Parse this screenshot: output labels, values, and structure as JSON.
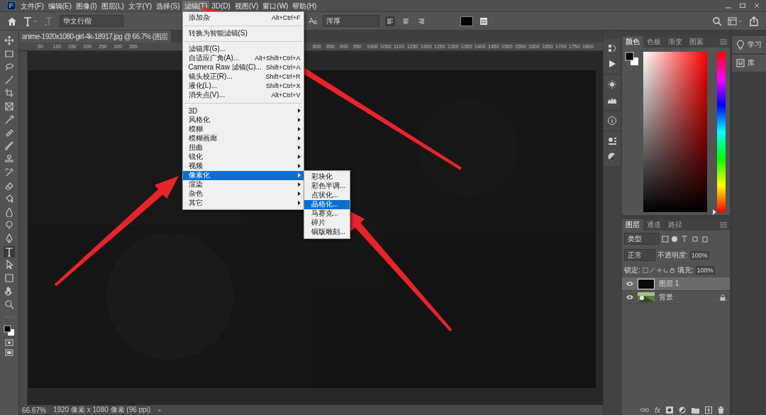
{
  "menu_bar": {
    "items": [
      {
        "label": "文件(F)",
        "selected": false
      },
      {
        "label": "编辑(E)",
        "selected": false
      },
      {
        "label": "图像(I)",
        "selected": false
      },
      {
        "label": "图层(L)",
        "selected": false
      },
      {
        "label": "文字(Y)",
        "selected": false
      },
      {
        "label": "选择(S)",
        "selected": false
      },
      {
        "label": "滤镜(T)",
        "selected": true
      },
      {
        "label": "3D(D)",
        "selected": false
      },
      {
        "label": "视图(V)",
        "selected": false
      },
      {
        "label": "窗口(W)",
        "selected": false
      },
      {
        "label": "帮助(H)",
        "selected": false
      }
    ]
  },
  "options_bar": {
    "font_family": "华文行楷",
    "anti_alias": "浑厚"
  },
  "document_tab": {
    "title": "anime-1920x1080-girl-4k-18917.jpg @ 66.7% (图层"
  },
  "ruler": {
    "labels_before_menu": [
      "50",
      "100",
      "150",
      "200",
      "250",
      "300",
      "350"
    ],
    "labels_after_menu": [
      "800",
      "850",
      "900",
      "950",
      "1000",
      "1050",
      "1100",
      "1150",
      "1200",
      "1250",
      "1300",
      "1350",
      "1400",
      "1450",
      "1500",
      "1550",
      "1600",
      "1650",
      "1700",
      "1750",
      "1800"
    ]
  },
  "toolbar": {
    "tools": [
      {
        "kind": "move",
        "selected": false
      },
      {
        "kind": "marquee",
        "selected": false
      },
      {
        "kind": "lasso",
        "selected": false
      },
      {
        "kind": "wand",
        "selected": false
      },
      {
        "kind": "crop",
        "selected": false
      },
      {
        "kind": "frame",
        "selected": false
      },
      {
        "kind": "eyedropper",
        "selected": false
      },
      {
        "kind": "healing",
        "selected": false
      },
      {
        "kind": "brush",
        "selected": false
      },
      {
        "kind": "stamp",
        "selected": false
      },
      {
        "kind": "history",
        "selected": false
      },
      {
        "kind": "eraser",
        "selected": false
      },
      {
        "kind": "bucket",
        "selected": false
      },
      {
        "kind": "drop",
        "selected": false
      },
      {
        "kind": "dodge",
        "selected": false
      },
      {
        "kind": "pen",
        "selected": false
      },
      {
        "kind": "type",
        "selected": true
      },
      {
        "kind": "select",
        "selected": false
      },
      {
        "kind": "shape",
        "selected": false
      },
      {
        "kind": "hand",
        "selected": false
      },
      {
        "kind": "zoom",
        "selected": false
      },
      {
        "kind": "more",
        "selected": false
      }
    ]
  },
  "filter_menu": {
    "items": [
      {
        "kind": "command",
        "label": "添加杂",
        "shortcut": "Alt+Ctrl+F",
        "selected": false
      },
      {
        "kind": "separator"
      },
      {
        "kind": "command",
        "label": "转换为智能滤镜(S)",
        "selected": false
      },
      {
        "kind": "separator"
      },
      {
        "kind": "command",
        "label": "滤镜库(G)...",
        "selected": false
      },
      {
        "kind": "command",
        "label": "自适应广角(A)...",
        "shortcut": "Alt+Shift+Ctrl+A",
        "selected": false
      },
      {
        "kind": "command",
        "label": "Camera Raw 滤镜(C)...",
        "shortcut": "Shift+Ctrl+A",
        "selected": false
      },
      {
        "kind": "command",
        "label": "镜头校正(R)...",
        "shortcut": "Shift+Ctrl+R",
        "selected": false
      },
      {
        "kind": "command",
        "label": "液化(L)...",
        "shortcut": "Shift+Ctrl+X",
        "selected": false
      },
      {
        "kind": "command",
        "label": "消失点(V)...",
        "shortcut": "Alt+Ctrl+V",
        "selected": false
      },
      {
        "kind": "separator"
      },
      {
        "kind": "submenu",
        "label": "3D",
        "selected": false
      },
      {
        "kind": "submenu",
        "label": "风格化",
        "selected": false
      },
      {
        "kind": "submenu",
        "label": "模糊",
        "selected": false
      },
      {
        "kind": "submenu",
        "label": "模糊画廊",
        "selected": false
      },
      {
        "kind": "submenu",
        "label": "扭曲",
        "selected": false
      },
      {
        "kind": "submenu",
        "label": "锐化",
        "selected": false
      },
      {
        "kind": "submenu",
        "label": "视频",
        "selected": false
      },
      {
        "kind": "submenu",
        "label": "像素化",
        "selected": true
      },
      {
        "kind": "submenu",
        "label": "渲染",
        "selected": false
      },
      {
        "kind": "submenu",
        "label": "杂色",
        "selected": false
      },
      {
        "kind": "submenu",
        "label": "其它",
        "selected": false
      }
    ]
  },
  "pixelate_submenu": {
    "items": [
      {
        "label": "彩块化",
        "selected": false
      },
      {
        "label": "彩色半调...",
        "selected": false
      },
      {
        "label": "点状化...",
        "selected": false
      },
      {
        "label": "晶格化...",
        "selected": true
      },
      {
        "label": "马赛克...",
        "selected": false
      },
      {
        "label": "碎片",
        "selected": false
      },
      {
        "label": "铜版雕刻...",
        "selected": false
      }
    ]
  },
  "color_panel": {
    "hue_slider": {
      "level": 0
    },
    "tabs": [
      {
        "label": "颜色",
        "selected": true
      },
      {
        "label": "色板",
        "selected": false
      },
      {
        "label": "渐变",
        "selected": false
      },
      {
        "label": "图案",
        "selected": false
      }
    ]
  },
  "learn_panel": {
    "items": [
      {
        "kind": "learn",
        "label": "学习"
      },
      {
        "kind": "library",
        "label": "库"
      }
    ]
  },
  "layers_panel": {
    "tabs": [
      {
        "label": "图层",
        "selected": true
      },
      {
        "label": "通道",
        "selected": false
      },
      {
        "label": "路径",
        "selected": false
      }
    ],
    "filter_kind": "类型",
    "blend_mode": "正常",
    "opacity_label": "不透明度:",
    "opacity": "100%",
    "lock_label": "锁定:",
    "fill_label": "填充:",
    "fill": "100%",
    "fx_label": "fx",
    "layers": [
      {
        "name": "图层 1",
        "kind": "fill",
        "selected": true,
        "visible": true,
        "locked": false
      },
      {
        "name": "背景",
        "kind": "picture",
        "selected": false,
        "visible": true,
        "locked": true
      }
    ]
  },
  "status_bar": {
    "zoom": "66.67%",
    "document_size": "1920 像素 x 1080 像素 (96 ppi)",
    "arrow": ">"
  }
}
